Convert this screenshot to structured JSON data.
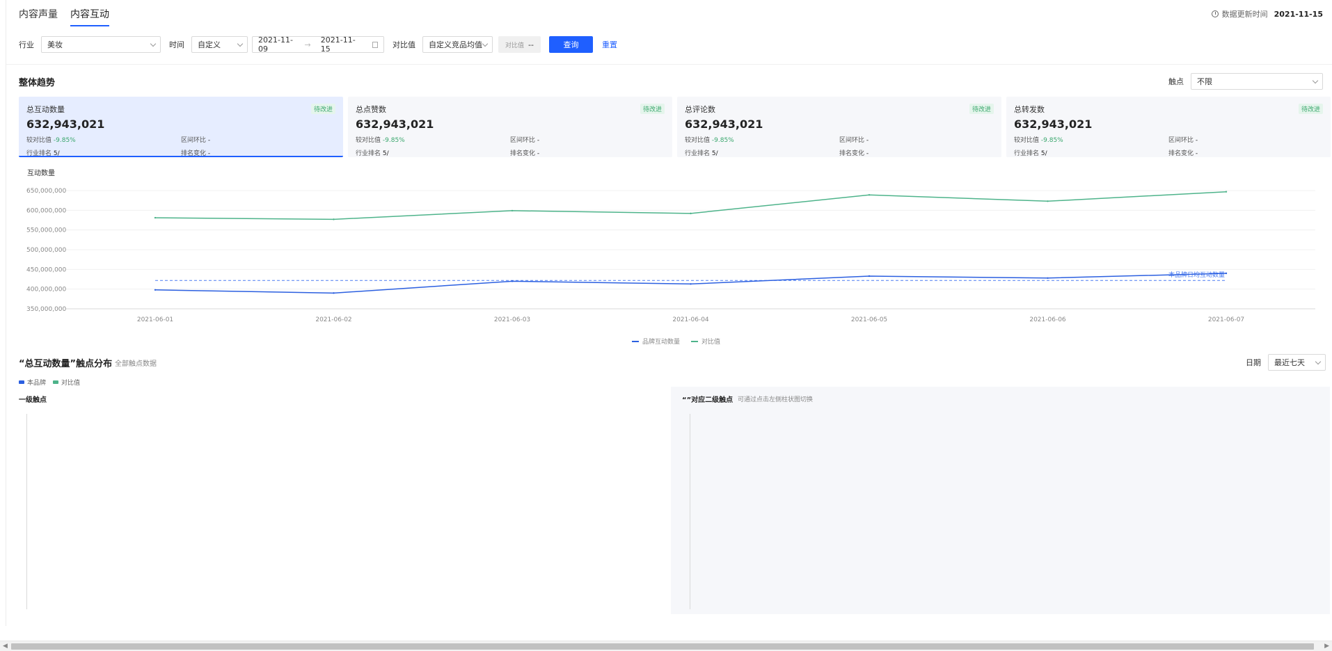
{
  "tabs": [
    {
      "label": "内容声量",
      "active": false
    },
    {
      "label": "内容互动",
      "active": true
    }
  ],
  "update": {
    "label": "数据更新时间",
    "date": "2021-11-15"
  },
  "filters": {
    "industry_label": "行业",
    "industry_value": "美妆",
    "time_label": "时间",
    "time_value": "自定义",
    "date_start": "2021-11-09",
    "date_end": "2021-11-15",
    "compare_label": "对比值",
    "compare_value": "自定义竞品均值",
    "compare_box_label": "对比值",
    "compare_box_value": "--",
    "query_button": "查询",
    "reset_link": "重置"
  },
  "overview": {
    "title": "整体趋势",
    "touch_label": "触点",
    "touch_value": "不限"
  },
  "cards": [
    {
      "title": "总互动数量",
      "value": "632,943,021",
      "badge": "待改进",
      "cmp_label": "较对比值",
      "cmp_value": "-9.85%",
      "ring_label": "区间环比",
      "ring_value": "-",
      "rank_label": "行业排名",
      "rank_value": "5/",
      "rank_change_label": "排名变化",
      "rank_change_value": "-"
    },
    {
      "title": "总点赞数",
      "value": "632,943,021",
      "badge": "待改进",
      "cmp_label": "较对比值",
      "cmp_value": "-9.85%",
      "ring_label": "区间环比",
      "ring_value": "-",
      "rank_label": "行业排名",
      "rank_value": "5/",
      "rank_change_label": "排名变化",
      "rank_change_value": "-"
    },
    {
      "title": "总评论数",
      "value": "632,943,021",
      "badge": "待改进",
      "cmp_label": "较对比值",
      "cmp_value": "-9.85%",
      "ring_label": "区间环比",
      "ring_value": "-",
      "rank_label": "行业排名",
      "rank_value": "5/",
      "rank_change_label": "排名变化",
      "rank_change_value": "-"
    },
    {
      "title": "总转发数",
      "value": "632,943,021",
      "badge": "待改进",
      "cmp_label": "较对比值",
      "cmp_value": "-9.85%",
      "ring_label": "区间环比",
      "ring_value": "-",
      "rank_label": "行业排名",
      "rank_value": "5/",
      "rank_change_label": "排名变化",
      "rank_change_value": "-"
    }
  ],
  "chart_data": {
    "type": "line",
    "ylabel": "互动数量",
    "x": [
      "2021-06-01",
      "2021-06-02",
      "2021-06-03",
      "2021-06-04",
      "2021-06-05",
      "2021-06-06",
      "2021-06-07"
    ],
    "y_ticks": [
      "650,000,000",
      "600,000,000",
      "550,000,000",
      "500,000,000",
      "450,000,000",
      "400,000,000",
      "350,000,000"
    ],
    "ylim": [
      350000000,
      650000000
    ],
    "series": [
      {
        "name": "品牌互动数量",
        "color": "#2b5fe0",
        "values": [
          398000000,
          390000000,
          420000000,
          413000000,
          433000000,
          428000000,
          440000000
        ]
      },
      {
        "name": "对比值",
        "color": "#4db38a",
        "values": [
          581000000,
          577000000,
          599000000,
          592000000,
          639000000,
          623000000,
          647000000
        ]
      }
    ],
    "average_line": {
      "label": "本品牌日均互动数量",
      "value": 422000000,
      "color": "#4a7cf2"
    },
    "grid": true,
    "legend_position": "bottom"
  },
  "distribution": {
    "title": "“总互动数量”触点分布",
    "subtitle": "全部触点数据",
    "date_label": "日期",
    "date_value": "最近七天",
    "legend": [
      {
        "name": "本品牌",
        "color": "#2b5fe0"
      },
      {
        "name": "对比值",
        "color": "#4db38a"
      }
    ],
    "level1_title": "一级触点",
    "level2_title": "“”对应二级触点",
    "level2_hint": "可通过点击左侧柱状图切换"
  },
  "scrollbar": {
    "left_arrow": "◀",
    "right_arrow": "▶"
  }
}
